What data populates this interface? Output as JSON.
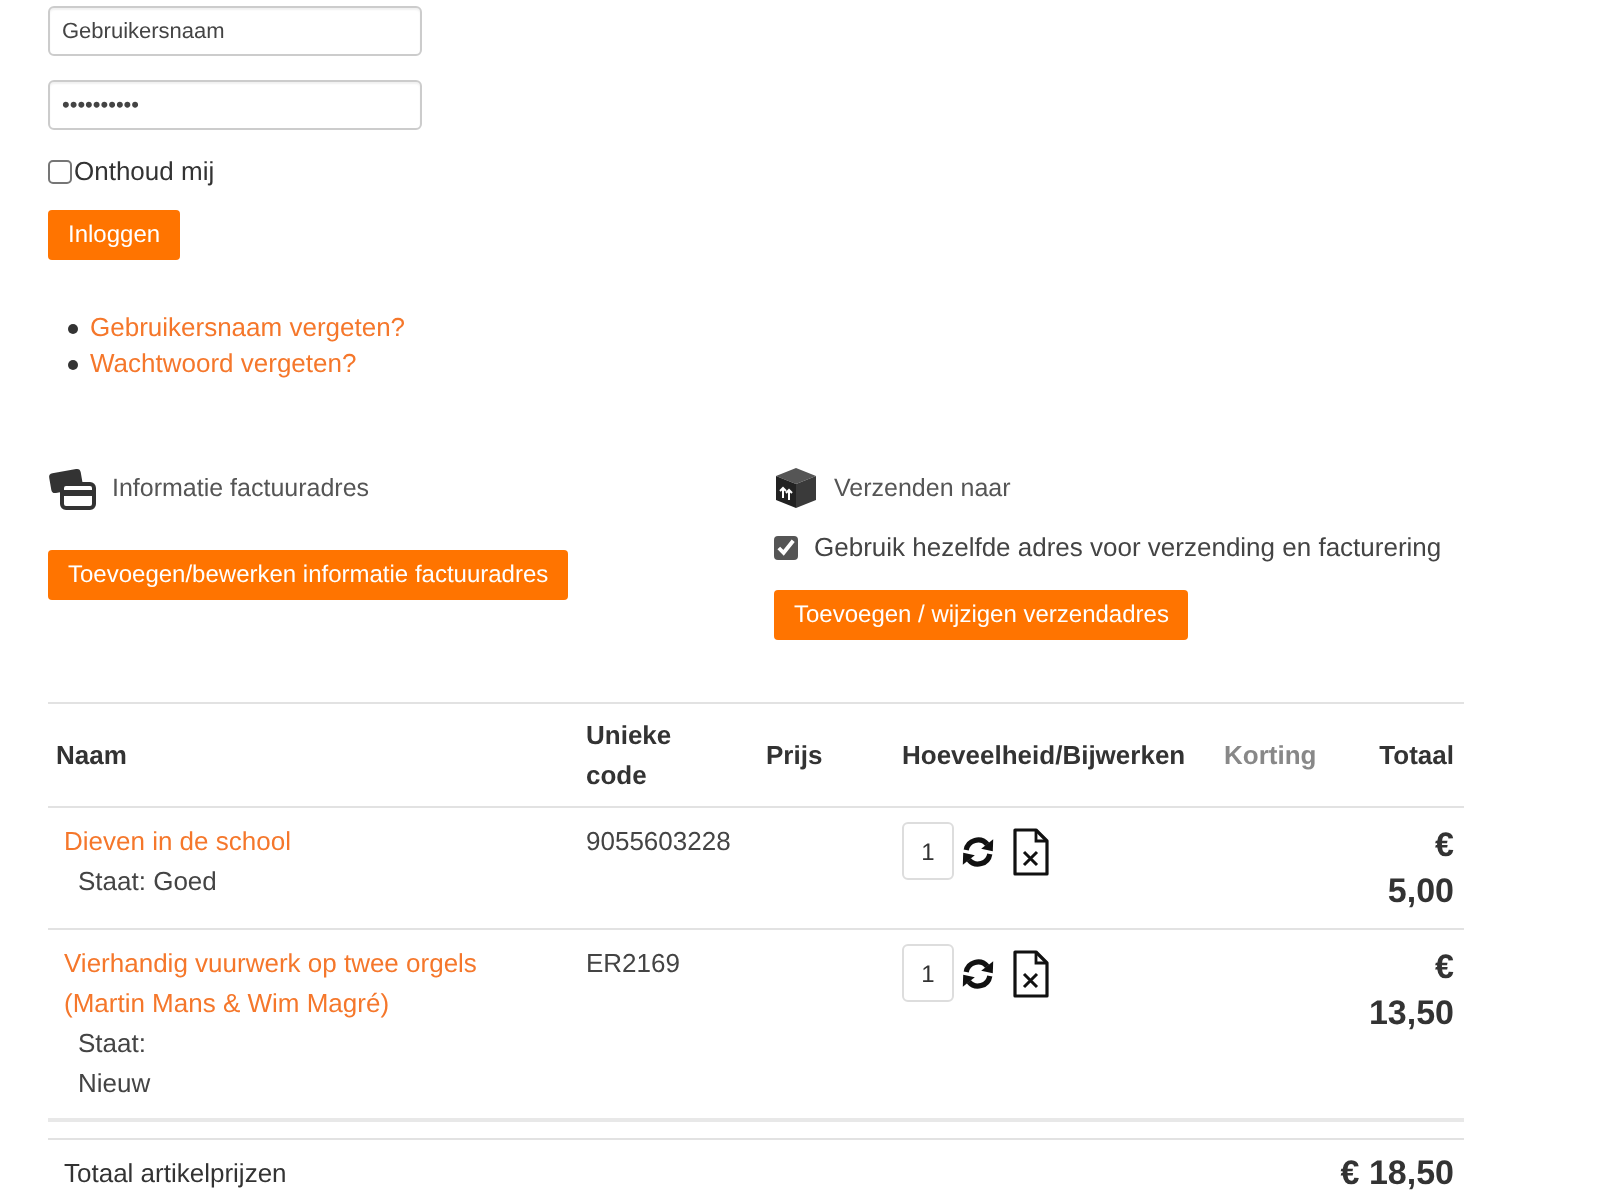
{
  "login": {
    "username": {
      "value": "Gebruikersnaam"
    },
    "password": {
      "value": "••••••••••"
    },
    "remember": {
      "label": "Onthoud mij",
      "checked": false
    },
    "submit": "Inloggen",
    "links": [
      "Gebruikersnaam vergeten?",
      "Wachtwoord vergeten?"
    ]
  },
  "billing": {
    "title": "Informatie factuuradres",
    "button": "Toevoegen/bewerken informatie factuuradres"
  },
  "shipping": {
    "title": "Verzenden naar",
    "same_address": {
      "label": "Gebruik hezelfde adres voor verzending en facturering",
      "checked": true
    },
    "button": "Toevoegen / wijzigen verzendadres"
  },
  "cart": {
    "columns": [
      {
        "label": "Naam",
        "muted": false
      },
      {
        "label": "Unieke code",
        "muted": false
      },
      {
        "label": "Prijs",
        "muted": false
      },
      {
        "label": "Hoeveelheid/Bijwerken",
        "muted": false
      },
      {
        "label": "Korting",
        "muted": true
      },
      {
        "label": "Totaal",
        "muted": false
      }
    ],
    "rows": [
      {
        "name": "Dieven in de school",
        "condition": "Staat: Goed",
        "code": "9055603228",
        "quantity": "1",
        "total": "€ 5,00"
      },
      {
        "name": "Vierhandig vuurwerk op twee orgels (Martin Mans & Wim Magré)",
        "condition": "Staat:\nNieuw",
        "code": "ER2169",
        "quantity": "1",
        "total": "€ 13,50"
      }
    ],
    "summary": {
      "label": "Totaal artikelprijzen",
      "value": "€ 18,50"
    }
  }
}
